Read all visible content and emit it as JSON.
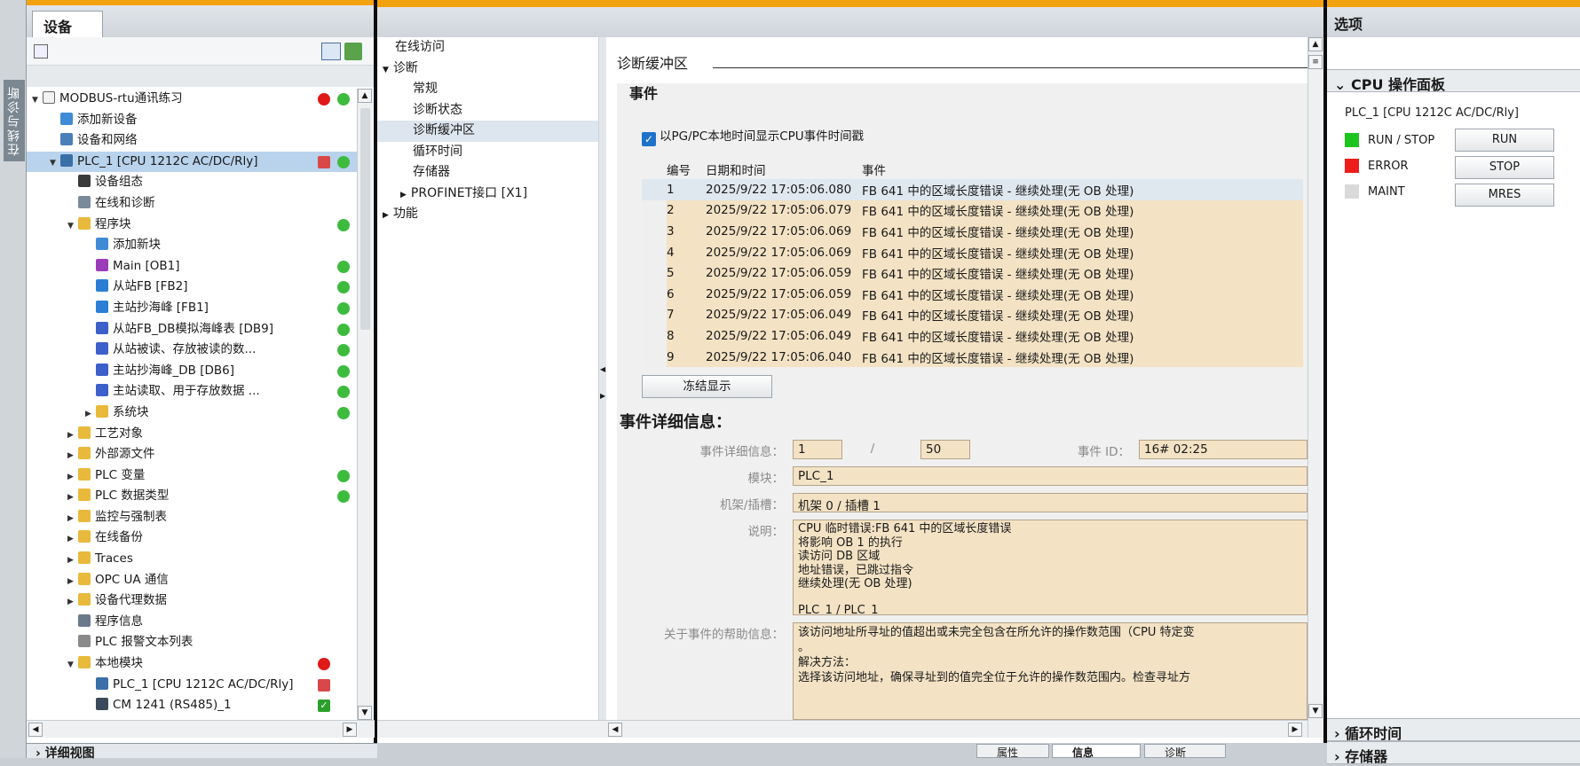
{
  "sidetab": {
    "label": "在线与诊断"
  },
  "project": {
    "tab": "设备",
    "tree": [
      {
        "label": "MODBUS-rtu通讯练习",
        "indent": 0,
        "arrow": "▼",
        "icon": "project-icon",
        "status": "error-green"
      },
      {
        "label": "添加新设备",
        "indent": 1,
        "arrow": "",
        "icon": "add-device-icon",
        "status": ""
      },
      {
        "label": "设备和网络",
        "indent": 1,
        "arrow": "",
        "icon": "network-icon",
        "status": ""
      },
      {
        "label": "PLC_1 [CPU 1212C AC/DC/Rly]",
        "indent": 1,
        "arrow": "▼",
        "icon": "plc-icon",
        "status": "warn-green",
        "selected": true
      },
      {
        "label": "设备组态",
        "indent": 2,
        "arrow": "",
        "icon": "device-config-icon",
        "status": ""
      },
      {
        "label": "在线和诊断",
        "indent": 2,
        "arrow": "",
        "icon": "online-diag-icon",
        "status": ""
      },
      {
        "label": "程序块",
        "indent": 2,
        "arrow": "▼",
        "icon": "folder-icon",
        "status": "green"
      },
      {
        "label": "添加新块",
        "indent": 3,
        "arrow": "",
        "icon": "add-block-icon",
        "status": ""
      },
      {
        "label": "Main [OB1]",
        "indent": 3,
        "arrow": "",
        "icon": "ob-icon",
        "status": "green"
      },
      {
        "label": "从站FB [FB2]",
        "indent": 3,
        "arrow": "",
        "icon": "fb-icon",
        "status": "green"
      },
      {
        "label": "主站抄海峰 [FB1]",
        "indent": 3,
        "arrow": "",
        "icon": "fb-icon",
        "status": "green"
      },
      {
        "label": "从站FB_DB模拟海峰表 [DB9]",
        "indent": 3,
        "arrow": "",
        "icon": "db-icon",
        "status": "green"
      },
      {
        "label": "从站被读、存放被读的数...",
        "indent": 3,
        "arrow": "",
        "icon": "db-icon",
        "status": "green"
      },
      {
        "label": "主站抄海峰_DB [DB6]",
        "indent": 3,
        "arrow": "",
        "icon": "db-icon",
        "status": "green"
      },
      {
        "label": "主站读取、用于存放数据 ...",
        "indent": 3,
        "arrow": "",
        "icon": "db-icon",
        "status": "green"
      },
      {
        "label": "系统块",
        "indent": 3,
        "arrow": "▶",
        "icon": "folder-icon",
        "status": "green"
      },
      {
        "label": "工艺对象",
        "indent": 2,
        "arrow": "▶",
        "icon": "folder-icon",
        "status": ""
      },
      {
        "label": "外部源文件",
        "indent": 2,
        "arrow": "▶",
        "icon": "folder-icon",
        "status": ""
      },
      {
        "label": "PLC 变量",
        "indent": 2,
        "arrow": "▶",
        "icon": "folder-icon",
        "status": "green"
      },
      {
        "label": "PLC 数据类型",
        "indent": 2,
        "arrow": "▶",
        "icon": "folder-icon",
        "status": "green"
      },
      {
        "label": "监控与强制表",
        "indent": 2,
        "arrow": "▶",
        "icon": "folder-icon",
        "status": ""
      },
      {
        "label": "在线备份",
        "indent": 2,
        "arrow": "▶",
        "icon": "folder-icon",
        "status": ""
      },
      {
        "label": "Traces",
        "indent": 2,
        "arrow": "▶",
        "icon": "folder-icon",
        "status": ""
      },
      {
        "label": "OPC UA 通信",
        "indent": 2,
        "arrow": "▶",
        "icon": "folder-icon",
        "status": ""
      },
      {
        "label": "设备代理数据",
        "indent": 2,
        "arrow": "▶",
        "icon": "folder-icon",
        "status": ""
      },
      {
        "label": "程序信息",
        "indent": 2,
        "arrow": "",
        "icon": "program-info-icon",
        "status": ""
      },
      {
        "label": "PLC 报警文本列表",
        "indent": 2,
        "arrow": "",
        "icon": "alarm-text-icon",
        "status": ""
      },
      {
        "label": "本地模块",
        "indent": 2,
        "arrow": "▼",
        "icon": "folder-icon",
        "status": "error"
      },
      {
        "label": "PLC_1 [CPU 1212C AC/DC/Rly]",
        "indent": 3,
        "arrow": "",
        "icon": "plc-icon",
        "status": "warn"
      },
      {
        "label": "CM 1241 (RS485)_1",
        "indent": 3,
        "arrow": "",
        "icon": "module-icon",
        "status": "ok"
      }
    ],
    "detail_view": "详细视图"
  },
  "nav": {
    "items": [
      {
        "label": "在线访问",
        "indent": 0,
        "arrow": ""
      },
      {
        "label": "诊断",
        "indent": 0,
        "arrow": "▼"
      },
      {
        "label": "常规",
        "indent": 1,
        "arrow": ""
      },
      {
        "label": "诊断状态",
        "indent": 1,
        "arrow": ""
      },
      {
        "label": "诊断缓冲区",
        "indent": 1,
        "arrow": "",
        "selected": true
      },
      {
        "label": "循环时间",
        "indent": 1,
        "arrow": ""
      },
      {
        "label": "存储器",
        "indent": 1,
        "arrow": ""
      },
      {
        "label": "PROFINET接口 [X1]",
        "indent": 1,
        "arrow": "▶"
      },
      {
        "label": "功能",
        "indent": 0,
        "arrow": "▶"
      }
    ]
  },
  "buffer": {
    "section_title": "诊断缓冲区",
    "events_label": "事件",
    "checkbox_label": "以PG/PC本地时间显示CPU事件时间戳",
    "columns": [
      "编号",
      "日期和时间",
      "事件"
    ],
    "rows": [
      {
        "no": "1",
        "time": "2025/9/22 17:05:06.080",
        "event": "FB 641 中的区域长度错误 - 继续处理(无 OB 处理)"
      },
      {
        "no": "2",
        "time": "2025/9/22 17:05:06.079",
        "event": "FB 641 中的区域长度错误 - 继续处理(无 OB 处理)"
      },
      {
        "no": "3",
        "time": "2025/9/22 17:05:06.069",
        "event": "FB 641 中的区域长度错误 - 继续处理(无 OB 处理)"
      },
      {
        "no": "4",
        "time": "2025/9/22 17:05:06.069",
        "event": "FB 641 中的区域长度错误 - 继续处理(无 OB 处理)"
      },
      {
        "no": "5",
        "time": "2025/9/22 17:05:06.059",
        "event": "FB 641 中的区域长度错误 - 继续处理(无 OB 处理)"
      },
      {
        "no": "6",
        "time": "2025/9/22 17:05:06.059",
        "event": "FB 641 中的区域长度错误 - 继续处理(无 OB 处理)"
      },
      {
        "no": "7",
        "time": "2025/9/22 17:05:06.049",
        "event": "FB 641 中的区域长度错误 - 继续处理(无 OB 处理)"
      },
      {
        "no": "8",
        "time": "2025/9/22 17:05:06.049",
        "event": "FB 641 中的区域长度错误 - 继续处理(无 OB 处理)"
      },
      {
        "no": "9",
        "time": "2025/9/22 17:05:06.040",
        "event": "FB 641 中的区域长度错误 - 继续处理(无 OB 处理)"
      }
    ],
    "freeze_button": "冻结显示",
    "details_title": "事件详细信息：",
    "detail_info_label": "事件详细信息：",
    "detail_info_value": "1",
    "detail_slash": "/",
    "detail_info_total": "50",
    "event_id_label": "事件 ID：",
    "event_id_value": "16# 02:25",
    "module_label": "模块：",
    "module_value": "PLC_1",
    "rack_label": "机架/插槽：",
    "rack_value": "机架 0 / 插槽 1",
    "desc_label": "说明：",
    "desc_lines": [
      "CPU 临时错误:FB 641 中的区域长度错误",
      "将影响 OB 1 的执行",
      "读访问 DB 区域",
      "地址错误，已跳过指令",
      " 继续处理(无 OB 处理)",
      "",
      "PLC_1 / PLC_1"
    ],
    "help_label": "关于事件的帮助信息：",
    "help_lines": [
      "该访问地址所寻址的值超出或未完全包含在所允许的操作数范围（CPU 特定变",
      "。",
      "解决方法：",
      "选择该访问地址，确保寻址到的值完全位于允许的操作数范围内。检查寻址方"
    ]
  },
  "bottom_tabs": {
    "properties": "属性",
    "info": "信息",
    "diagnostics": "诊断"
  },
  "options": {
    "title": "选项",
    "cpu_panel_title": "CPU 操作面板",
    "device": "PLC_1 [CPU 1212C AC/DC/Rly]",
    "leds": [
      {
        "label": "RUN / STOP",
        "color": "#1ec41e"
      },
      {
        "label": "ERROR",
        "color": "#ee1c1c"
      },
      {
        "label": "MAINT",
        "color": "#d9d9d9"
      }
    ],
    "buttons": [
      "RUN",
      "STOP",
      "MRES"
    ],
    "cycle_time": "循环时间",
    "memory": "存储器"
  }
}
